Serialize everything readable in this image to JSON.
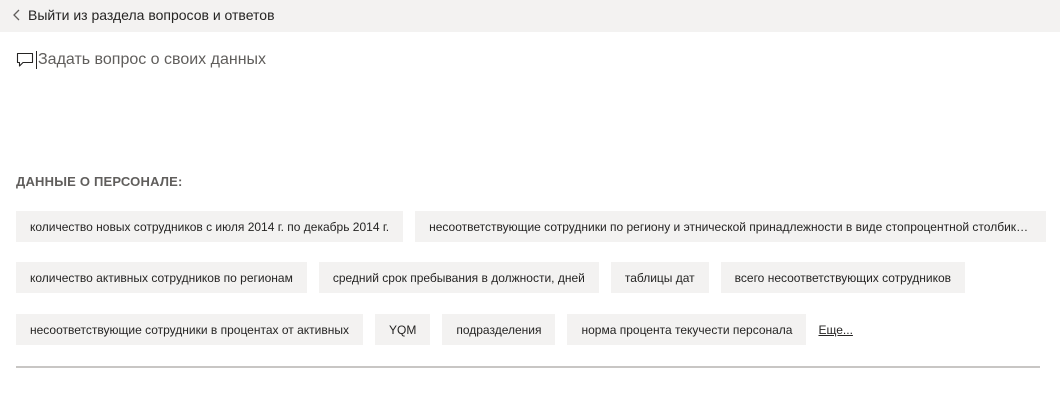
{
  "header": {
    "back_label": "Выйти из раздела вопросов и ответов"
  },
  "qa": {
    "placeholder": "Задать вопрос о своих данных",
    "value": ""
  },
  "suggestions": {
    "title": "ДАННЫЕ О ПЕРСОНАЛЕ:",
    "rows": [
      [
        "количество новых сотрудников с июля 2014 г. по декабрь 2014 г.",
        "несоответствующие сотрудники по региону и этнической принадлежности в виде стопроцентной столбико..."
      ],
      [
        "количество активных сотрудников по регионам",
        "средний срок пребывания в должности, дней",
        "таблицы дат",
        "всего несоответствующих сотрудников"
      ],
      [
        "несоответствующие сотрудники в процентах от активных",
        "YQM",
        "подразделения",
        "норма процента текучести персонала"
      ]
    ],
    "more_label": "Еще..."
  },
  "icons": {
    "back": "chevron-left-icon",
    "qa": "chat-bubble-icon"
  },
  "colors": {
    "topbar_bg": "#f3f2f1",
    "chip_bg": "#f3f2f1",
    "text": "#252423",
    "muted": "#605e5c",
    "divider": "#c8c6c4"
  }
}
